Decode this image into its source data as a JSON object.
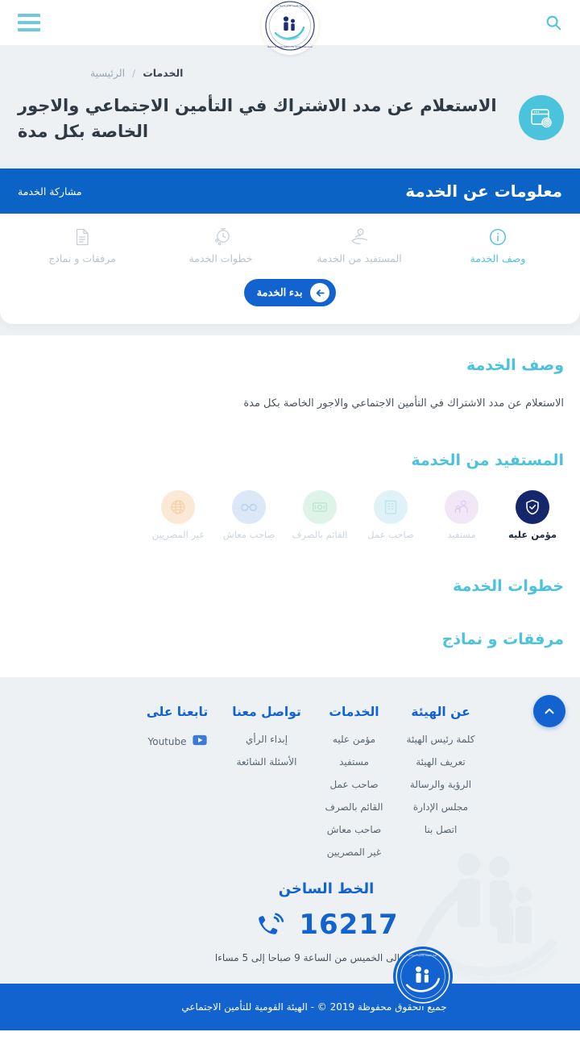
{
  "topbar": {
    "search_label": "بحث",
    "menu_label": "القائمة",
    "logo_alt": "الهيئة القومية للتأمين الاجتماعي"
  },
  "hero": {
    "breadcrumb": {
      "current": "الخدمات",
      "separator": "/",
      "home": "الرئيسية"
    },
    "title": "الاستعلام عن مدد الاشتراك في التأمين الاجتماعي والاجور الخاصة بكل مدة",
    "icon": "browser-gear-icon"
  },
  "service_card": {
    "info_bar_title": "معلومات عن الخدمة",
    "share_label": "مشاركة الخدمة",
    "tabs": [
      {
        "label": "وصف الخدمة",
        "icon": "info-circle-icon",
        "active": true
      },
      {
        "label": "المستفيد من الخدمة",
        "icon": "hand-person-icon",
        "active": false
      },
      {
        "label": "خطوات الخدمة",
        "icon": "stopwatch-gears-icon",
        "active": false
      },
      {
        "label": "مرفقات و نماذج",
        "icon": "document-icon",
        "active": false
      }
    ],
    "start_button": "بدء الخدمة",
    "start_button_icon": "arrow-left-circle-icon"
  },
  "sections": {
    "description": {
      "heading": "وصف الخدمة",
      "text": "الاستعلام عن مدد الاشتراك في التأمين الاجتماعي والاجور الخاصة بكل مدة"
    },
    "beneficiary": {
      "heading": "المستفيد من الخدمة",
      "items": [
        {
          "label": "مؤمن عليه",
          "icon": "shield-check-icon",
          "active": true,
          "bg": "#14276b",
          "fg": "#ffffff"
        },
        {
          "label": "مستفيد",
          "icon": "family-person-icon",
          "active": false,
          "bg": "#f1e7f7",
          "fg": "#e3d4ee"
        },
        {
          "label": "صاحب عمل",
          "icon": "building-icon",
          "active": false,
          "bg": "#dff2f8",
          "fg": "#c6e6f1"
        },
        {
          "label": "القائم بالصرف",
          "icon": "money-icon",
          "active": false,
          "bg": "#dff4e8",
          "fg": "#c3e9d5"
        },
        {
          "label": "صاحب معاش",
          "icon": "glasses-icon",
          "active": false,
          "bg": "#dce8f7",
          "fg": "#bed5ef"
        },
        {
          "label": "غير المصريين",
          "icon": "globe-icon",
          "active": false,
          "bg": "#fbe9d6",
          "fg": "#f5d6b4"
        }
      ]
    },
    "steps": {
      "heading": "خطوات الخدمة"
    },
    "attachments": {
      "heading": "مرفقات و نماذج"
    }
  },
  "scroll_top": {
    "label": "للأعلى",
    "icon": "chevron-up-icon"
  },
  "footer": {
    "columns": [
      {
        "title": "عن الهيئة",
        "links": [
          "كلمة رئيس الهيئة",
          "تعريف الهيئة",
          "الرؤية والرسالة",
          "مجلس الإدارة",
          "اتصل بنا"
        ]
      },
      {
        "title": "الخدمات",
        "links": [
          "مؤمن عليه",
          "مستفيد",
          "صاحب عمل",
          "القائم بالصرف",
          "صاحب معاش",
          "غير المصريين"
        ]
      },
      {
        "title": "تواصل معنا",
        "links": [
          "إبداء الرأي",
          "الأسئلة الشائعة"
        ]
      },
      {
        "title": "تابعنا على",
        "links": [],
        "social": [
          {
            "label": "Youtube",
            "icon": "youtube-icon"
          }
        ]
      }
    ],
    "hotline": {
      "title": "الخط الساخن",
      "number": "16217",
      "icon": "phone-ring-icon",
      "hours": "من الأحد إلى الخميس من الساعة 9 صباحا إلى 5 مساءا"
    },
    "copyright": "جميع الحقوق محفوظة 2019 © - الهيئة القومية للتأمين الاجتماعي",
    "seal_alt": "شعار الهيئة"
  },
  "colors": {
    "primary_blue": "#1263cf",
    "info_bar_blue": "#0b63c5",
    "cyan": "#4cc3dd",
    "navy": "#14276b",
    "hero_bg": "#edf1f4",
    "muted_text": "#b9c3cc"
  }
}
